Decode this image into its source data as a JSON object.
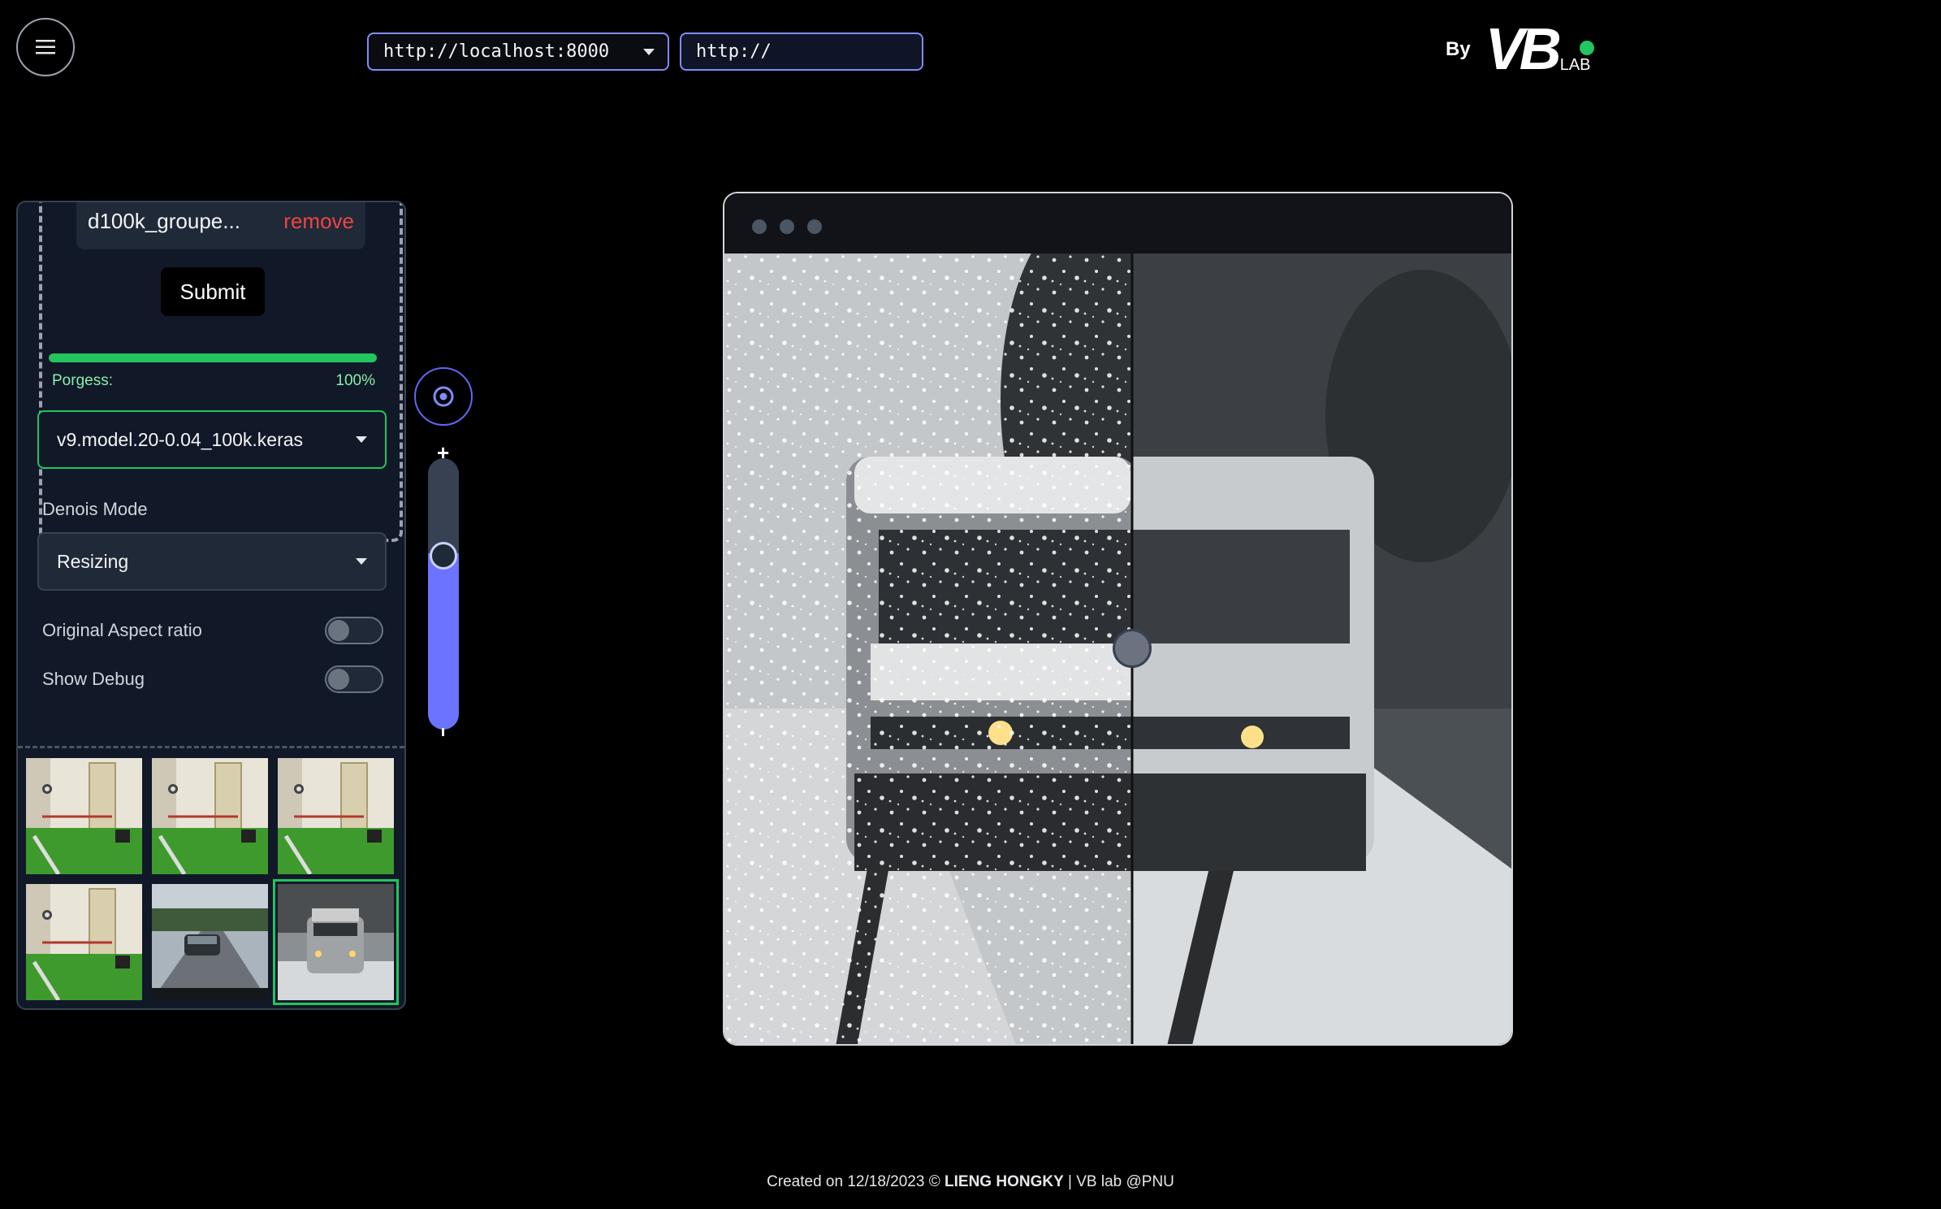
{
  "header": {
    "server_url": "http://localhost:8000",
    "custom_url_value": "http://",
    "brand_by": "By",
    "brand_logo": "VB",
    "brand_suffix": "LAB",
    "status_color": "#22c55e"
  },
  "upload": {
    "file_name": "d100k_groupe...",
    "remove_label": "remove",
    "submit_label": "Submit"
  },
  "progress": {
    "label": "Porgess:",
    "value_text": "100%",
    "value": 1.0
  },
  "model": {
    "selected": "v9.model.20-0.04_100k.keras"
  },
  "denoise": {
    "label": "Denois Mode",
    "selected": "Resizing"
  },
  "options": {
    "aspect_label": "Original Aspect ratio",
    "aspect_on": false,
    "debug_label": "Show Debug",
    "debug_on": false
  },
  "gallery": {
    "items": [
      {
        "scene": "corridor-door"
      },
      {
        "scene": "corridor-door"
      },
      {
        "scene": "corridor-door"
      },
      {
        "scene": "corridor-door"
      },
      {
        "scene": "road-car"
      },
      {
        "scene": "snow-truck",
        "selected": true
      }
    ]
  },
  "zoom": {
    "plus": "+",
    "level": 0.5
  },
  "viewer": {
    "split": 0.54
  },
  "footer": {
    "prefix": "Created on 12/18/2023 ©",
    "author": "LIENG HONGKY",
    "suffix": "| VB lab @PNU"
  },
  "colors": {
    "accent": "#6b73ff",
    "success": "#22c55e",
    "danger": "#ef4444"
  }
}
